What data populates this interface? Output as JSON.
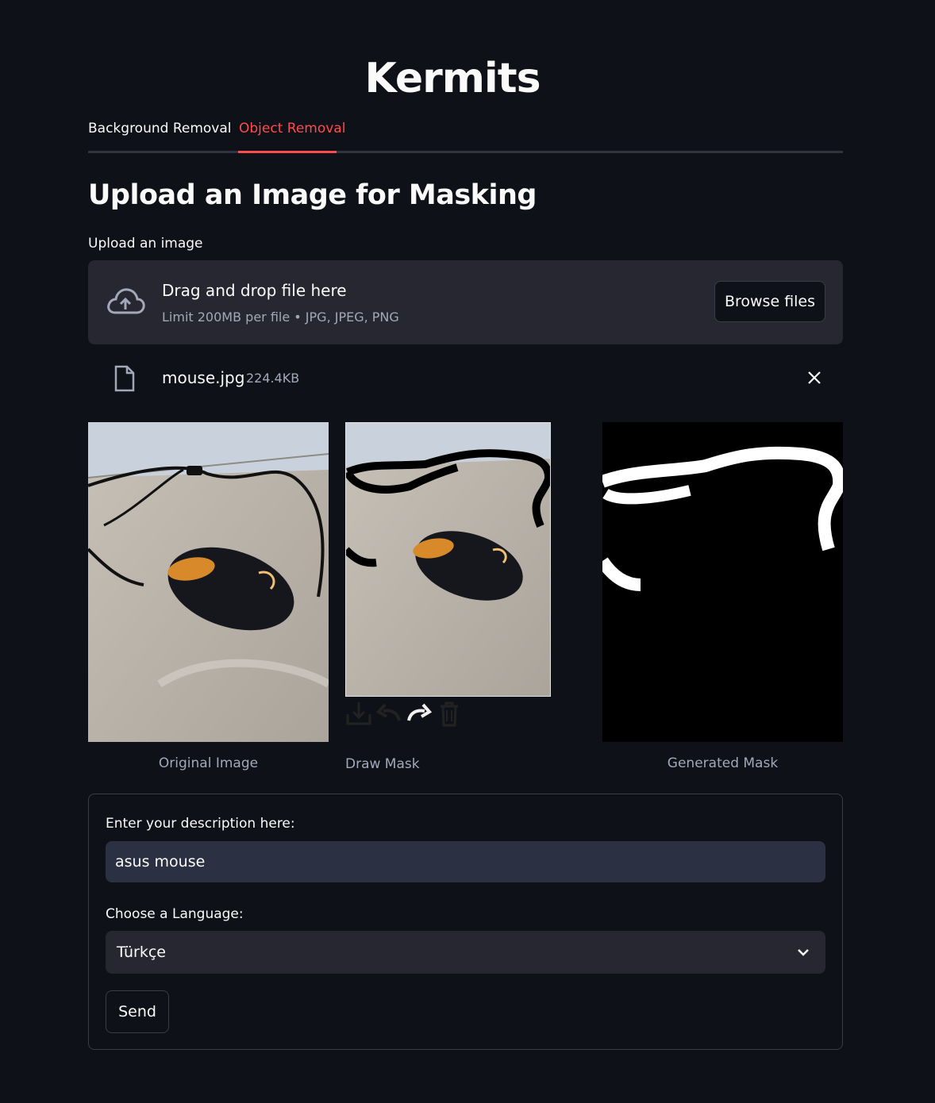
{
  "app": {
    "title": "Kermits"
  },
  "tabs": [
    {
      "label": "Background Removal",
      "active": false
    },
    {
      "label": "Object Removal",
      "active": true
    }
  ],
  "section": {
    "heading": "Upload an Image for Masking"
  },
  "uploader": {
    "label": "Upload an image",
    "drop_text": "Drag and drop file here",
    "limit_text": "Limit 200MB per file • JPG, JPEG, PNG",
    "browse_label": "Browse files"
  },
  "file": {
    "name": "mouse.jpg",
    "size": "224.4KB"
  },
  "images": {
    "original_caption": "Original Image",
    "draw_caption": "Draw Mask",
    "generated_caption": "Generated Mask"
  },
  "canvas_tools": [
    "download-icon",
    "undo-icon",
    "redo-icon",
    "trash-icon"
  ],
  "form": {
    "description_label": "Enter your description here:",
    "description_value": "asus mouse",
    "language_label": "Choose a Language:",
    "language_value": "Türkçe",
    "send_label": "Send"
  },
  "colors": {
    "background": "#0e1117",
    "accent": "#ff4b4b",
    "panel": "#262730",
    "input": "#2b3142"
  }
}
